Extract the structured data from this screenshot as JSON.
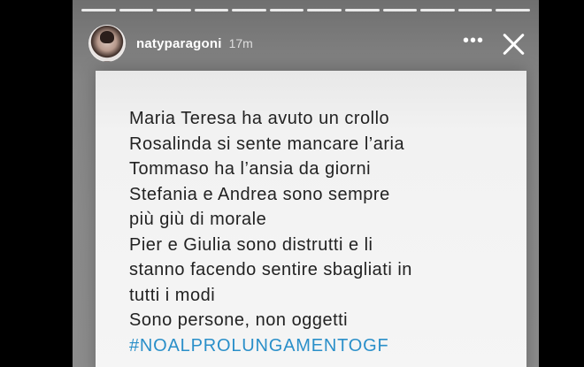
{
  "story": {
    "username": "natyparagoni",
    "time": "17m",
    "more_label": "•••",
    "segments": 12
  },
  "post": {
    "lines": [
      "Maria Teresa ha avuto un crollo",
      "Rosalinda si sente mancare l’aria",
      "Tommaso ha l’ansia da giorni",
      "Stefania e Andrea sono sempre",
      "più giù di morale",
      "Pier e Giulia sono distrutti e li",
      "stanno facendo sentire sbagliati in",
      "tutti i modi",
      "Sono persone, non oggetti"
    ],
    "hashtag": "#NOALPROLUNGAMENTOGF"
  },
  "icons": {
    "more": "more-options-icon",
    "close": "close-icon",
    "avatar": "avatar"
  },
  "colors": {
    "hashtag": "#2a8fc9",
    "text": "#222222",
    "background": "#000000"
  }
}
